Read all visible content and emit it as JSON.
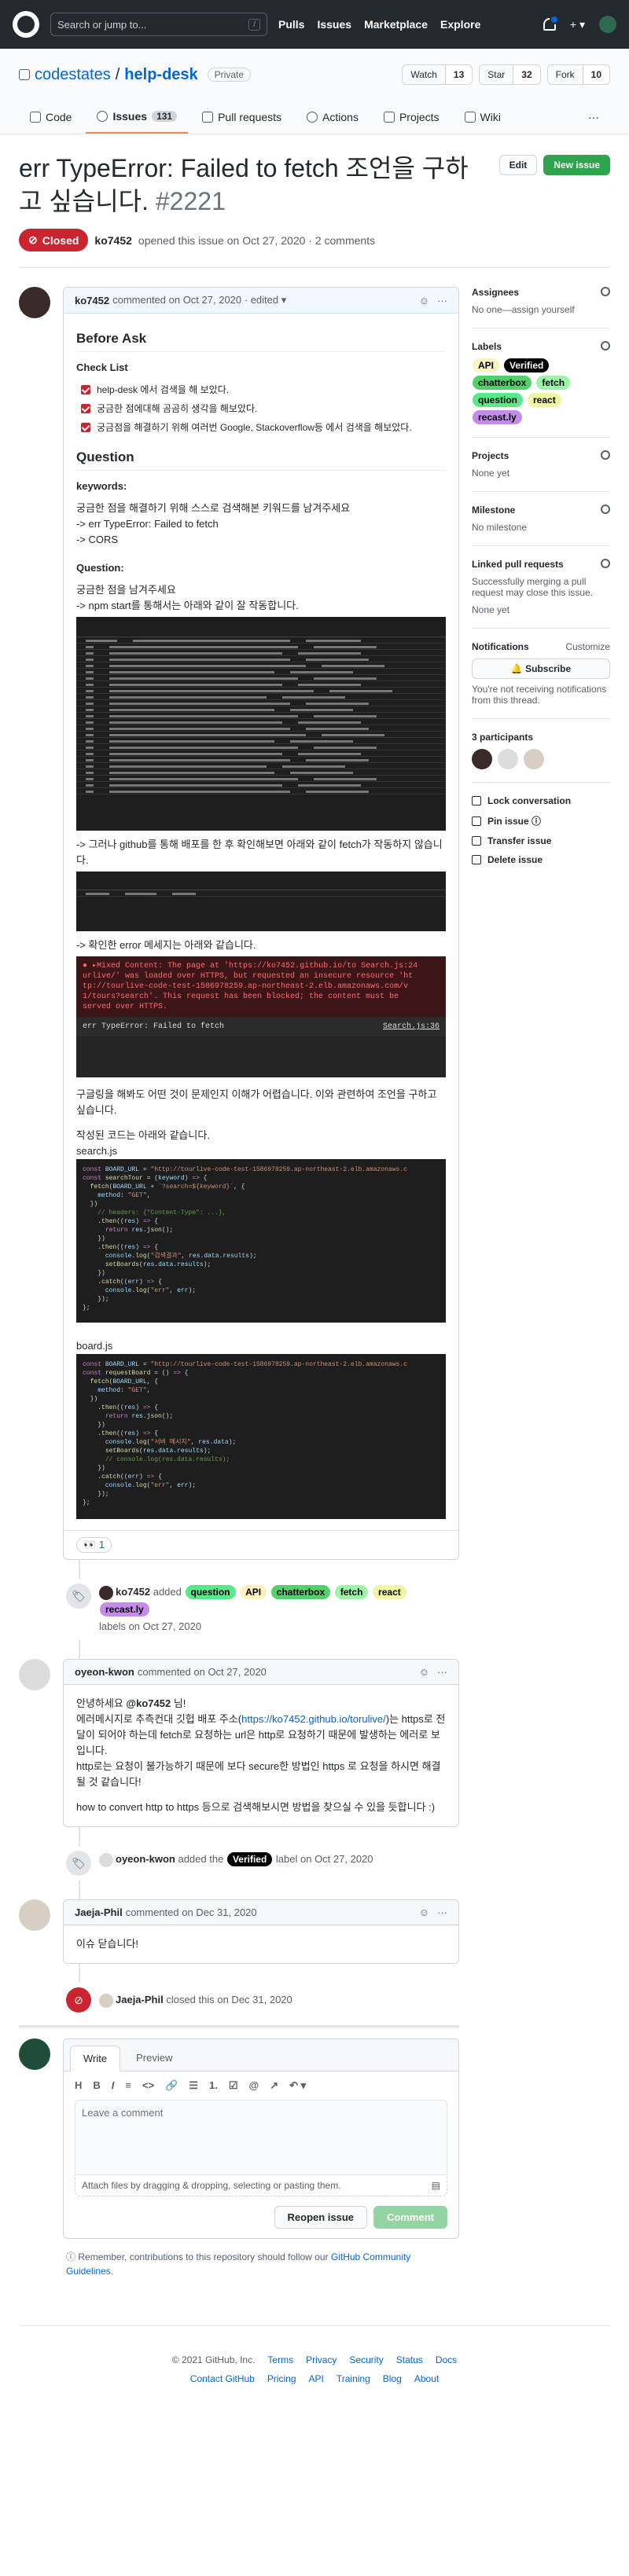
{
  "header": {
    "search_placeholder": "Search or jump to...",
    "slash": "/",
    "nav": [
      "Pulls",
      "Issues",
      "Marketplace",
      "Explore"
    ],
    "plus": "+ ▾"
  },
  "repo": {
    "owner": "codestates",
    "sep": "/",
    "name": "help-desk",
    "visibility": "Private",
    "watch": "Watch",
    "watch_count": "13",
    "star": "Star",
    "star_count": "32",
    "fork": "Fork",
    "fork_count": "10",
    "tabs": [
      {
        "label": "Code"
      },
      {
        "label": "Issues",
        "count": "131"
      },
      {
        "label": "Pull requests"
      },
      {
        "label": "Actions"
      },
      {
        "label": "Projects"
      },
      {
        "label": "Wiki"
      }
    ],
    "more": "···"
  },
  "issue": {
    "title": "err TypeError: Failed to fetch 조언을 구하고 싶습니다.",
    "number": "#2221",
    "edit": "Edit",
    "new_issue": "New issue",
    "status": "Closed",
    "opened_by": "ko7452",
    "opened_text": "opened this issue on Oct 27, 2020 · 2 comments"
  },
  "comment1": {
    "author": "ko7452",
    "meta": "commented on Oct 27, 2020 · edited ▾",
    "h_before": "Before Ask",
    "h_check": "Check List",
    "checks": [
      "help-desk 에서 검색을 해 보았다.",
      "궁금한 점에대해 곰곰히 생각을 해보았다.",
      "궁금점을 해결하기 위해 여러번 Google, Stackoverflow등 에서 검색을 해보았다."
    ],
    "h_question": "Question",
    "keywords_label": "keywords:",
    "keywords": [
      "궁금한 점을 해결하기 위해 스스로 검색해본 키워드를 남겨주세요",
      "-> err TypeError: Failed to fetch",
      "-> CORS"
    ],
    "question_label": "Question:",
    "q_lines": [
      "궁금한 점을 남겨주세요",
      "-> npm start를 통해서는 아래와 같이 잘 작동합니다."
    ],
    "p2": "-> 그러나 github를 통해 배포를 한 후 확인해보면 아래와 같이 fetch가 작동하지 않습니다.",
    "p3": "-> 확인한 error 메세지는 아래와 같습니다.",
    "err_line1": "● ▸Mixed Content: The page at 'https://ko7452.github.io/to Search.js:24",
    "err_line2": "urlive/' was loaded over HTTPS, but requested an insecure resource 'ht",
    "err_line3": "tp://tourlive-code-test-1586978259.ap-northeast-2.elb.amazonaws.com/v",
    "err_line4": "1/tours?search'. This request has been blocked; the content must be",
    "err_line5": "served over HTTPS.",
    "err_fetch": "err TypeError: Failed to fetch",
    "err_src": "Search.js:36",
    "p4": "구글링을 해봐도 어떤 것이 문제인지 이해가 어렵습니다. 이와 관련하여 조언을 구하고 싶습니다.",
    "p5": "작성된 코드는 아래와 같습니다.",
    "file1": "search.js",
    "file2": "board.js",
    "reaction_emoji": "👀",
    "reaction_count": "1"
  },
  "event1": {
    "actor": "ko7452",
    "added": "added",
    "labels": [
      "question",
      "API",
      "chatterbox",
      "fetch",
      "react",
      "recast.ly"
    ],
    "suffix": "labels on Oct 27, 2020"
  },
  "comment2": {
    "author": "oyeon-kwon",
    "meta": "commented on Oct 27, 2020",
    "l1a": "안녕하세요 ",
    "l1b": "@ko7452",
    "l1c": " 님!",
    "l2a": "에러메시지로 추측컨대 깃헙 배포 주소(",
    "l2b": "https://ko7452.github.io/torulive/",
    "l2c": ")는 https로 전달이 되어야 하는데 fetch로 요청하는 url은 http로 요청하기 때문에 발생하는 에러로 보입니다.",
    "l3": "http로는 요청이 불가능하기 때문에 보다 secure한 방법인 https 로 요청을 하시면 해결될 것 같습니다!",
    "l4": "how to convert http to https 등으로 검색해보시면 방법을 찾으실 수 있을 듯합니다 :)"
  },
  "event2": {
    "actor": "oyeon-kwon",
    "text": "added the",
    "label": "Verified",
    "suffix": "label on Oct 27, 2020"
  },
  "comment3": {
    "author": "Jaeja-Phil",
    "meta": "commented on Dec 31, 2020",
    "body": "이슈 닫습니다!"
  },
  "event3": {
    "actor": "Jaeja-Phil",
    "text": "closed this on Dec 31, 2020"
  },
  "composer": {
    "tab_write": "Write",
    "tab_preview": "Preview",
    "tools": [
      "H",
      "B",
      "I",
      "≡",
      "<>",
      "🔗",
      "☰",
      "1.",
      "☑",
      "@",
      "↗",
      "↶ ▾"
    ],
    "placeholder": "Leave a comment",
    "attach": "Attach files by dragging & dropping, selecting or pasting them.",
    "reopen": "Reopen issue",
    "comment": "Comment"
  },
  "notice": {
    "text": "Remember, contributions to this repository should follow our ",
    "link": "GitHub Community Guidelines",
    "end": "."
  },
  "sidebar": {
    "assignees_t": "Assignees",
    "assignees_v": "No one—assign yourself",
    "labels_t": "Labels",
    "labels": [
      {
        "name": "API",
        "bg": "#fef2c0"
      },
      {
        "name": "Verified",
        "bg": "#000000"
      },
      {
        "name": "chatterbox",
        "bg": "#52d168"
      },
      {
        "name": "fetch",
        "bg": "#9af5a8"
      },
      {
        "name": "question",
        "bg": "#58e88a"
      },
      {
        "name": "react",
        "bg": "#f0f5a1"
      },
      {
        "name": "recast.ly",
        "bg": "#c58bea"
      }
    ],
    "projects_t": "Projects",
    "projects_v": "None yet",
    "milestone_t": "Milestone",
    "milestone_v": "No milestone",
    "linked_t": "Linked pull requests",
    "linked_d": "Successfully merging a pull request may close this issue.",
    "linked_v": "None yet",
    "notif_t": "Notifications",
    "customize": "Customize",
    "subscribe": "🔔 Subscribe",
    "notif_d": "You're not receiving notifications from this thread.",
    "participants": "3 participants",
    "actions": [
      "Lock conversation",
      "Pin issue ⓘ",
      "Transfer issue",
      "Delete issue"
    ]
  },
  "footer": {
    "row1": [
      "© 2021 GitHub, Inc.",
      "Terms",
      "Privacy",
      "Security",
      "Status",
      "Docs"
    ],
    "row2": [
      "Contact GitHub",
      "Pricing",
      "API",
      "Training",
      "Blog",
      "About"
    ]
  }
}
